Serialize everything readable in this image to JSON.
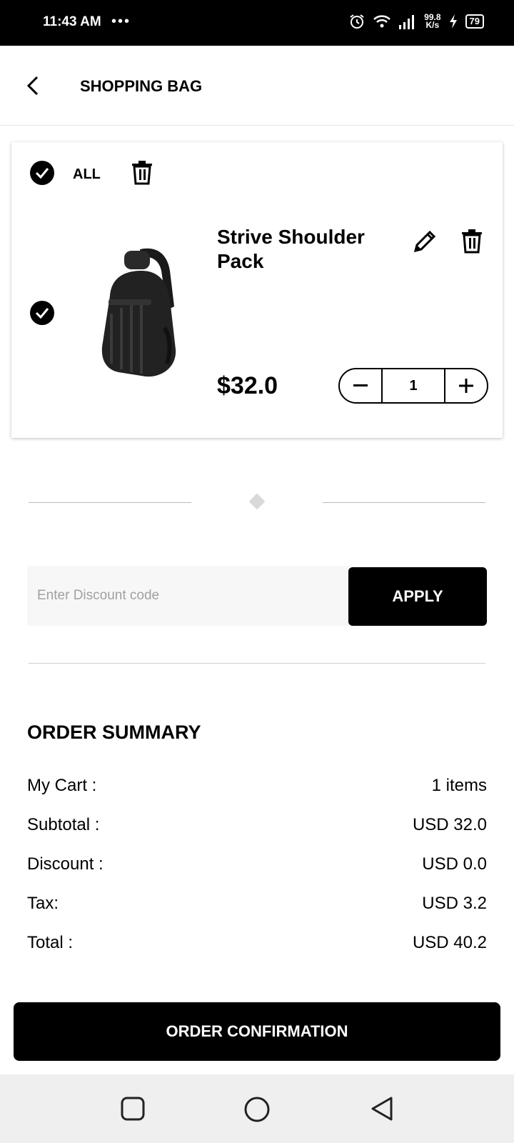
{
  "status_bar": {
    "time": "11:43 AM",
    "dots": "•••",
    "net_speed_value": "99.8",
    "net_speed_unit": "K/s",
    "battery": "79"
  },
  "app_bar": {
    "title": "SHOPPING BAG"
  },
  "cart": {
    "select_all_label": "ALL",
    "items": [
      {
        "name": "Strive Shoulder Pack",
        "price": "$32.0",
        "quantity": "1"
      }
    ]
  },
  "discount": {
    "placeholder": "Enter Discount code",
    "apply_label": "APPLY"
  },
  "summary": {
    "title": "ORDER SUMMARY",
    "rows": [
      {
        "label": "My Cart :",
        "value": "1 items"
      },
      {
        "label": "Subtotal :",
        "value": "USD 32.0"
      },
      {
        "label": "Discount :",
        "value": "USD 0.0"
      },
      {
        "label": "Tax:",
        "value": "USD 3.2"
      },
      {
        "label": "Total :",
        "value": "USD 40.2"
      }
    ]
  },
  "confirm_label": "ORDER CONFIRMATION"
}
